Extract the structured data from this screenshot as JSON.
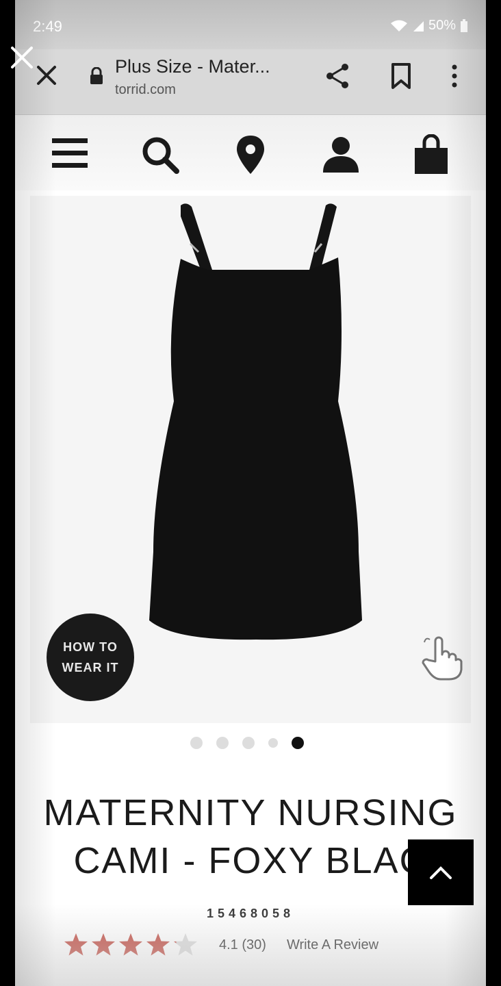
{
  "status_bar": {
    "time": "2:49",
    "battery": "50%"
  },
  "browser": {
    "tab_title": "Plus Size - Mater...",
    "domain": "torrid.com"
  },
  "site_header": {
    "icons": [
      "menu-icon",
      "search-icon",
      "location-pin-icon",
      "account-icon",
      "shopping-bag-icon"
    ]
  },
  "product": {
    "badge_line1": "HOW TO",
    "badge_line2": "WEAR IT",
    "carousel": {
      "count": 5,
      "active_index": 5
    },
    "title_line1": "MATERNITY NURSING",
    "title_line2": "CAMI - FOXY BLAC",
    "sku": "15468058",
    "rating": {
      "stars": 4.1,
      "text": "4.1 (30)"
    },
    "write_review": "Write A Review"
  },
  "colors": {
    "star": "#c75b52",
    "accent": "#000000"
  }
}
